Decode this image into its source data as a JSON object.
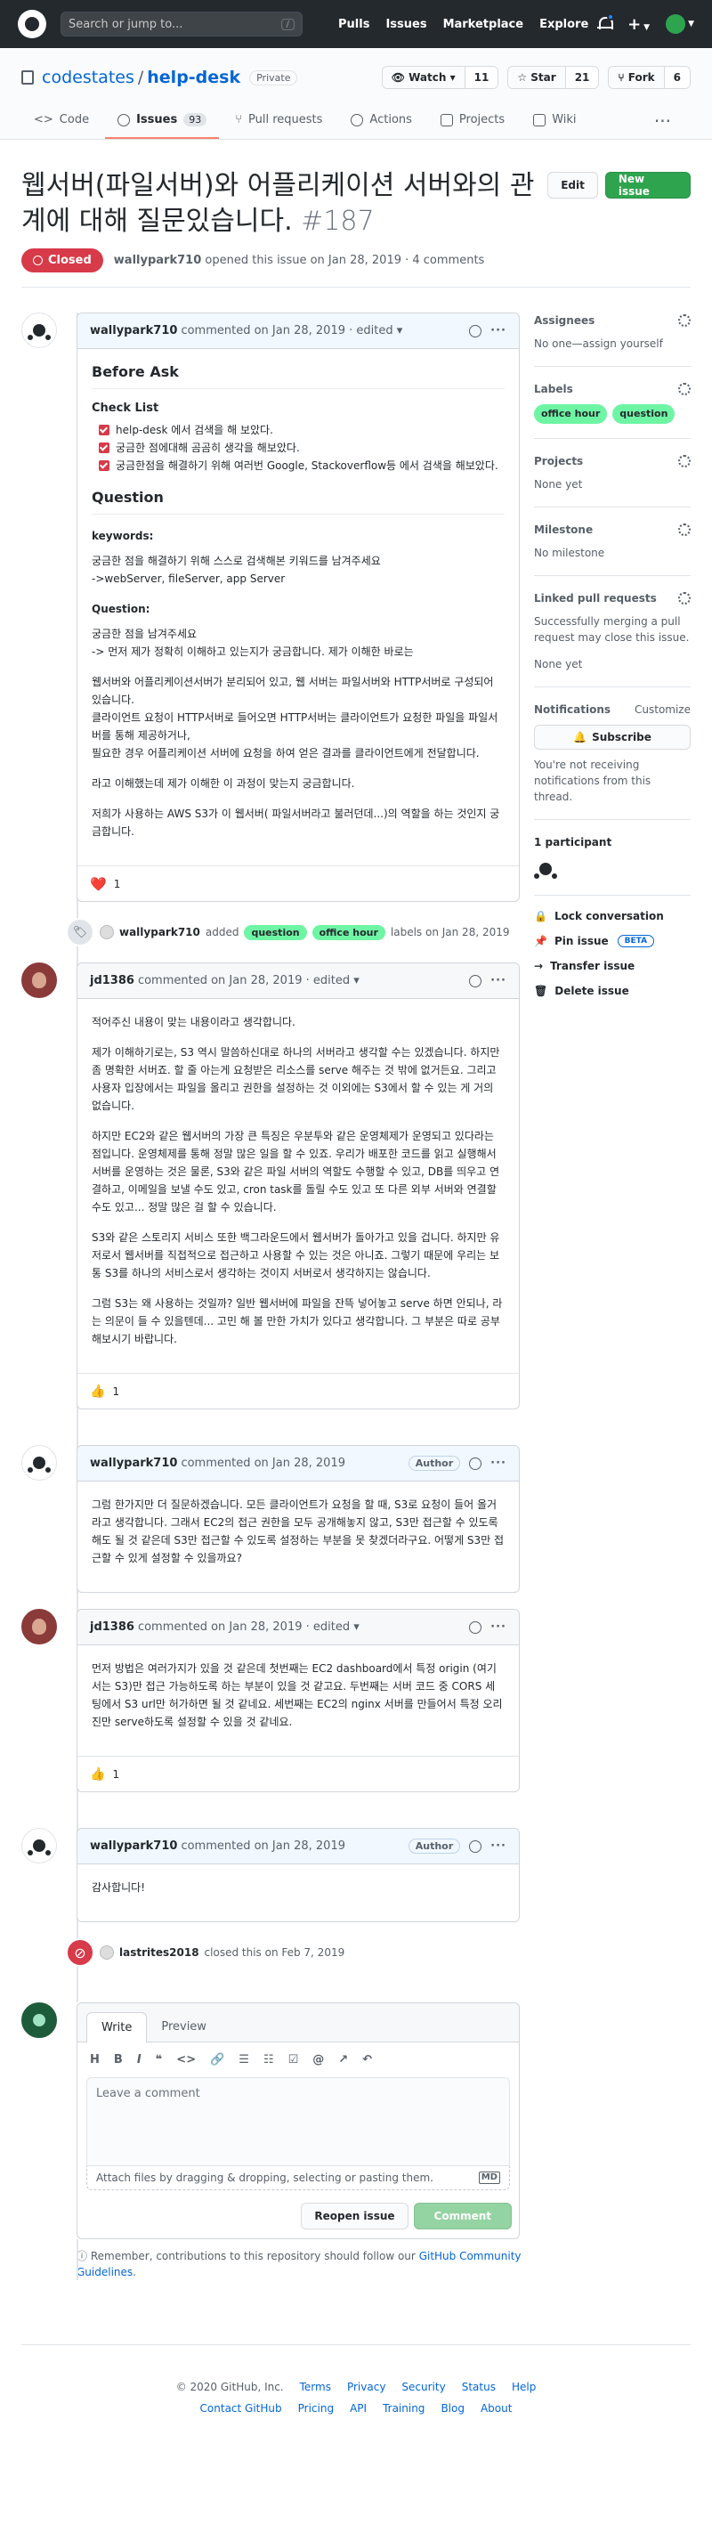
{
  "header": {
    "search_placeholder": "Search or jump to...",
    "slash": "/",
    "nav": [
      "Pulls",
      "Issues",
      "Marketplace",
      "Explore"
    ]
  },
  "repo": {
    "owner": "codestates",
    "sep": "/",
    "name": "help-desk",
    "visibility": "Private",
    "watch": {
      "label": "Watch",
      "count": "11"
    },
    "star": {
      "label": "Star",
      "count": "21"
    },
    "fork": {
      "label": "Fork",
      "count": "6"
    },
    "tabs": [
      {
        "label": "Code"
      },
      {
        "label": "Issues",
        "count": "93"
      },
      {
        "label": "Pull requests"
      },
      {
        "label": "Actions"
      },
      {
        "label": "Projects"
      },
      {
        "label": "Wiki"
      }
    ]
  },
  "issue": {
    "title": "웹서버(파일서버)와 어플리케이션 서버와의 관계에 대해 질문있습니다.",
    "number": "#187",
    "edit": "Edit",
    "new_issue": "New issue",
    "state": "Closed",
    "author": "wallypark710",
    "meta": "opened this issue on Jan 28, 2019 · 4 comments"
  },
  "c1": {
    "author": "wallypark710",
    "meta": "commented on Jan 28, 2019 · edited",
    "h_before": "Before Ask",
    "h_check": "Check List",
    "tasks": [
      "help-desk 에서 검색을 해 보았다.",
      "궁금한 점에대해 곰곰히 생각을 해보았다.",
      "궁금한점을 해결하기 위해 여러번 Google, Stackoverflow등 에서 검색을 해보았다."
    ],
    "h_question": "Question",
    "h_keywords": "keywords:",
    "p_keywords1": "궁금한 점을 해결하기 위해 스스로 검색해본 키워드를 남겨주세요",
    "p_keywords2": "->webServer, fileServer, app Server",
    "h_question2": "Question:",
    "p_q1": "궁금한 점을 남겨주세요",
    "p_q2": "-> 먼저 제가 정확히 이해하고 있는지가 궁금합니다. 제가 이해한 바로는",
    "p_q3": "웹서버와 어플리케이션서버가 분리되어 있고, 웹 서버는 파일서버와 HTTP서버로 구성되어 있습니다.",
    "p_q4": "클라이언트 요청이 HTTP서버로 들어오면 HTTP서버는 클라이언트가 요청한 파일을 파일서버를 통해 제공하거나,",
    "p_q5": "필요한 경우 어플리케이션 서버에 요청을 하여 얻은 결과를 클라이언트에게 전달합니다.",
    "p_q6": "라고 이해했는데 제가 이해한 이 과정이 맞는지 궁금합니다.",
    "p_q7": "저희가 사용하는 AWS S3가 이 웹서버( 파일서버라고 불러던데...)의 역할을 하는 것인지 궁금합니다.",
    "reaction": "❤️",
    "reaction_count": "1"
  },
  "ev1": {
    "user": "wallypark710",
    "text1": "added",
    "text2": "labels on Jan 28, 2019"
  },
  "c2": {
    "author": "jd1386",
    "meta": "commented on Jan 28, 2019 · edited",
    "p1": "적어주신 내용이 맞는 내용이라고 생각합니다.",
    "p2": "제가 이해하기로는, S3 역시 말씀하신대로 하나의 서버라고 생각할 수는 있겠습니다. 하지만 좀 명확한 서버죠. 할 줄 아는게 요청받은 리소스를 serve 해주는 것 밖에 없거든요. 그리고 사용자 입장에서는 파일을 올리고 권한을 설정하는 것 이외에는 S3에서 할 수 있는 게 거의 없습니다.",
    "p3": "하지만 EC2와 같은 웹서버의 가장 큰 특징은 우분투와 같은 운영체제가 운영되고 있다라는 점입니다. 운영체제를 통해 정말 많은 일을 할 수 있죠. 우리가 배포한 코드를 읽고 실행해서 서버를 운영하는 것은 물론, S3와 같은 파일 서버의 역할도 수행할 수 있고, DB를 띄우고 연결하고, 이메일을 보낼 수도 있고, cron task를 돌릴 수도 있고 또 다른 외부 서버와 연결할 수도 있고... 정말 많은 걸 할 수 있습니다.",
    "p4": "S3와 같은 스토리지 서비스 또한 백그라운드에서 웹서버가 돌아가고 있을 겁니다. 하지만 유저로서 웹서버를 직접적으로 접근하고 사용할 수 있는 것은 아니죠. 그렇기 때문에 우리는 보통 S3를 하나의 서비스로서 생각하는 것이지 서버로서 생각하지는 않습니다.",
    "p5": "그럼 S3는 왜 사용하는 것일까? 일반 웹서버에 파일을 잔뜩 넣어놓고 serve 하면 안되나, 라는 의문이 들 수 있을텐데... 고민 해 볼 만한 가치가 있다고 생각합니다. 그 부분은 따로 공부해보시기 바랍니다.",
    "reaction": "👍",
    "reaction_count": "1"
  },
  "c3": {
    "author": "wallypark710",
    "meta": "commented on Jan 28, 2019",
    "tag": "Author",
    "p1": "그럼 한가지만 더 질문하겠습니다. 모든 클라이언트가 요청을 할 때, S3로 요청이 들어 올거라고 생각합니다. 그래서 EC2의 접근 권한을 모두 공개해놓지 않고, S3만 접근할 수 있도록 해도 될 것 같은데 S3만 접근할 수 있도록 설정하는 부분을 못 찾겠더라구요. 어떻게 S3만 접근할 수 있게 설정할 수 있을까요?"
  },
  "c4": {
    "author": "jd1386",
    "meta": "commented on Jan 28, 2019 · edited",
    "p1": "먼저 방법은 여러가지가 있을 것 같은데 첫번째는 EC2 dashboard에서 특정 origin (여기서는 S3)만 접근 가능하도록 하는 부분이 있을 것 같고요. 두번째는 서버 코드 중 CORS 세팅에서 S3 url만 허가하면 될 것 같네요. 세번째는 EC2의 nginx 서버를 만들어서 특정 오리진만 serve하도록 설정할 수 있을 것 같네요.",
    "reaction": "👍",
    "reaction_count": "1"
  },
  "c5": {
    "author": "wallypark710",
    "meta": "commented on Jan 28, 2019",
    "tag": "Author",
    "p1": "감사합니다!"
  },
  "ev2": {
    "user": "lastrites2018",
    "text": "closed this on Feb 7, 2019"
  },
  "composer": {
    "tab_write": "Write",
    "tab_preview": "Preview",
    "toolbar": [
      "H",
      "B",
      "I",
      "❝",
      "<>",
      "🔗",
      "☰",
      "☷",
      "☑",
      "@",
      "↗",
      "↶"
    ],
    "placeholder": "Leave a comment",
    "attach": "Attach files by dragging & dropping, selecting or pasting them.",
    "md": "MD",
    "reopen": "Reopen issue",
    "comment": "Comment",
    "note1": "Remember, contributions to this repository should follow our",
    "note_link": "GitHub Community Guidelines",
    "note2": "."
  },
  "sidebar": {
    "assignees": {
      "title": "Assignees",
      "value": "No one—assign yourself"
    },
    "labels": {
      "title": "Labels"
    },
    "projects": {
      "title": "Projects",
      "value": "None yet"
    },
    "milestone": {
      "title": "Milestone",
      "value": "No milestone"
    },
    "linked": {
      "title": "Linked pull requests",
      "value": "Successfully merging a pull request may close this issue.",
      "value2": "None yet"
    },
    "notifications": {
      "title": "Notifications",
      "customize": "Customize",
      "subscribe": "Subscribe",
      "value": "You're not receiving notifications from this thread."
    },
    "participants": {
      "title": "1 participant"
    },
    "actions": [
      "Lock conversation",
      "Pin issue",
      "Transfer issue",
      "Delete issue"
    ],
    "pin_badge": "BETA"
  },
  "labels": [
    {
      "name": "office hour",
      "color": "#6ef5a4"
    },
    {
      "name": "question",
      "color": "#6ef5a4"
    }
  ],
  "labels_ev": [
    {
      "name": "question",
      "color": "#6ef5a4"
    },
    {
      "name": "office hour",
      "color": "#6ef5a4"
    }
  ],
  "footer": {
    "copyright": "© 2020 GitHub, Inc.",
    "row1": [
      "Terms",
      "Privacy",
      "Security",
      "Status",
      "Help"
    ],
    "row2": [
      "Contact GitHub",
      "Pricing",
      "API",
      "Training",
      "Blog",
      "About"
    ]
  }
}
